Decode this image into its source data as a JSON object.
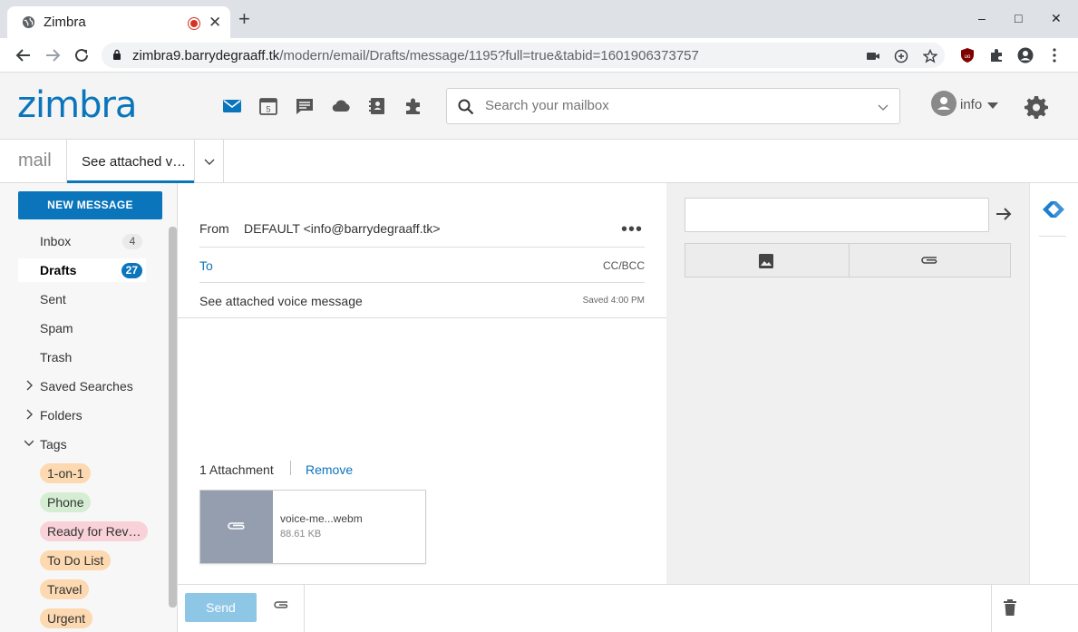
{
  "browser": {
    "tab_title": "Zimbra",
    "url_host": "zimbra9.barrydegraaff.tk",
    "url_path": "/modern/email/Drafts/message/1195?full=true&tabid=1601906373757",
    "win_minimize": "–",
    "win_maximize": "□",
    "win_close": "✕",
    "new_tab": "+",
    "tab_close": "✕"
  },
  "header": {
    "logo": "zimbra",
    "search_placeholder": "Search your mailbox",
    "account_name": "info",
    "calendar_day": "5"
  },
  "tabrow": {
    "section": "mail",
    "message_tab": "See attached v…"
  },
  "sidebar": {
    "new_message": "NEW MESSAGE",
    "folders": [
      {
        "label": "Inbox",
        "count": "4"
      },
      {
        "label": "Drafts",
        "count": "27"
      },
      {
        "label": "Sent",
        "count": ""
      },
      {
        "label": "Spam",
        "count": ""
      },
      {
        "label": "Trash",
        "count": ""
      }
    ],
    "saved_searches": "Saved Searches",
    "folders_tree": "Folders",
    "tags_tree": "Tags",
    "tags": [
      {
        "label": "1-on-1",
        "color": "#fcd9b0"
      },
      {
        "label": "Phone",
        "color": "#d5eed3"
      },
      {
        "label": "Ready for Rev…",
        "color": "#f9d1d8"
      },
      {
        "label": "To Do List",
        "color": "#fcd9b0"
      },
      {
        "label": "Travel",
        "color": "#fcd9b0"
      },
      {
        "label": "Urgent",
        "color": "#fcd9b0"
      }
    ]
  },
  "compose": {
    "from_label": "From",
    "from_value": "DEFAULT <info@barrydegraaff.tk>",
    "more": "•••",
    "to_label": "To",
    "ccbcc": "CC/BCC",
    "subject": "See attached voice message",
    "saved": "Saved 4:00 PM",
    "attachment_count": "1 Attachment",
    "remove": "Remove",
    "attachment": {
      "name": "voice-me...webm",
      "size": "88.61 KB"
    },
    "send": "Send"
  },
  "colors": {
    "accent": "#0b75bc",
    "send_disabled": "#8ec6e6"
  }
}
